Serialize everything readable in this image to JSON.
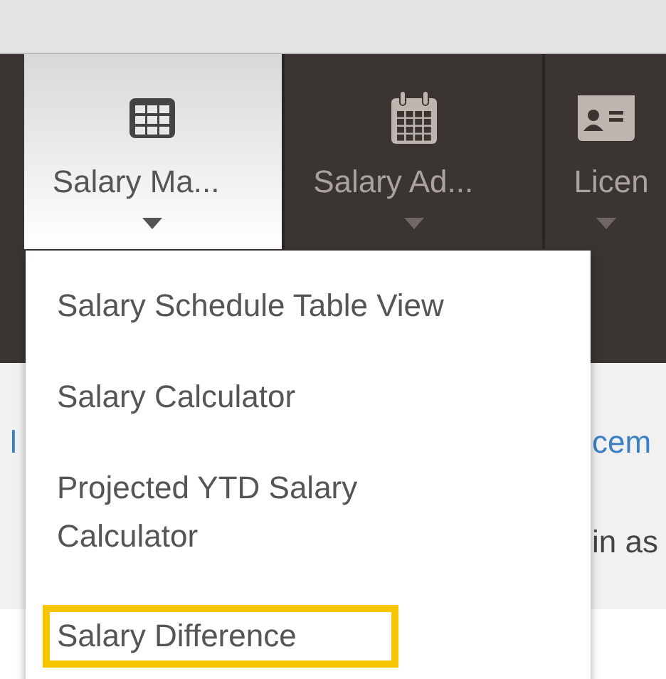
{
  "nav": {
    "tabs": [
      {
        "kind": "table",
        "label": "Salary Ma...",
        "selected": true
      },
      {
        "kind": "calendar",
        "label": "Salary Ad...",
        "selected": false
      },
      {
        "kind": "card",
        "label": "Licen",
        "selected": false
      }
    ]
  },
  "dropdown": {
    "items": [
      {
        "label": "Salary Schedule Table View",
        "highlighted": false
      },
      {
        "label": "Salary Calculator",
        "highlighted": false
      },
      {
        "label": "Projected YTD Salary Calculator",
        "highlighted": false
      },
      {
        "label": "Salary Difference",
        "highlighted": true
      }
    ]
  },
  "background_fragments": {
    "link_left": "l",
    "link_right": "cem",
    "text_right": "in as"
  }
}
